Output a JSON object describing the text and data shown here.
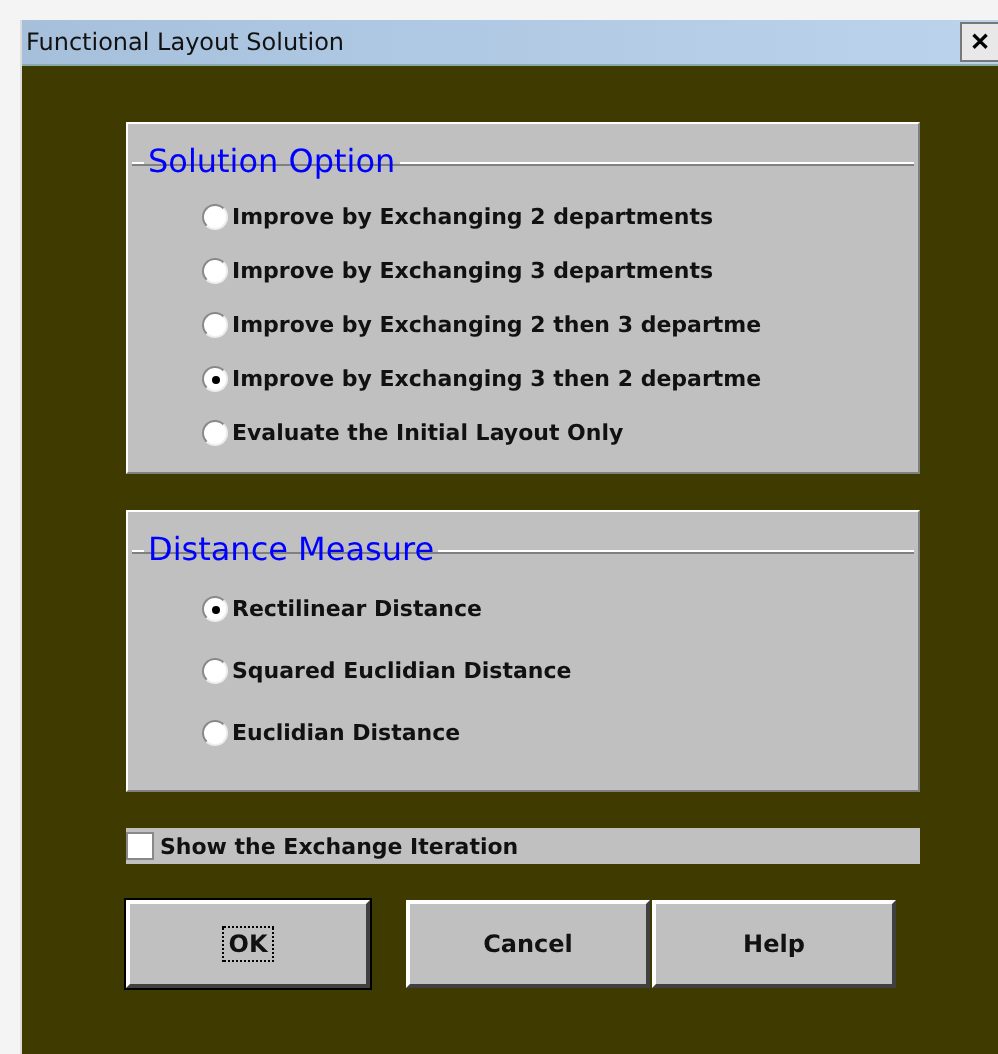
{
  "window": {
    "title": "Functional Layout Solution",
    "close": "✕"
  },
  "groups": [
    {
      "title": "Solution Option",
      "kind": "tight",
      "options": [
        {
          "label": "Improve by Exchanging 2 departments",
          "selected": false
        },
        {
          "label": "Improve by Exchanging 3 departments",
          "selected": false
        },
        {
          "label": "Improve by Exchanging 2 then 3 departme",
          "selected": false
        },
        {
          "label": "Improve by Exchanging 3 then 2 departme",
          "selected": true
        },
        {
          "label": "Evaluate the Initial Layout Only",
          "selected": false
        }
      ]
    },
    {
      "title": "Distance Measure",
      "kind": "loose",
      "options": [
        {
          "label": "Rectilinear Distance",
          "selected": true
        },
        {
          "label": "Squared Euclidian Distance",
          "selected": false
        },
        {
          "label": "Euclidian Distance",
          "selected": false
        }
      ]
    }
  ],
  "checkbox": {
    "label": "Show the Exchange Iteration",
    "checked": false
  },
  "buttons": [
    {
      "label": "OK",
      "default": true
    },
    {
      "label": "Cancel",
      "default": false
    },
    {
      "label": "Help",
      "default": false
    }
  ]
}
